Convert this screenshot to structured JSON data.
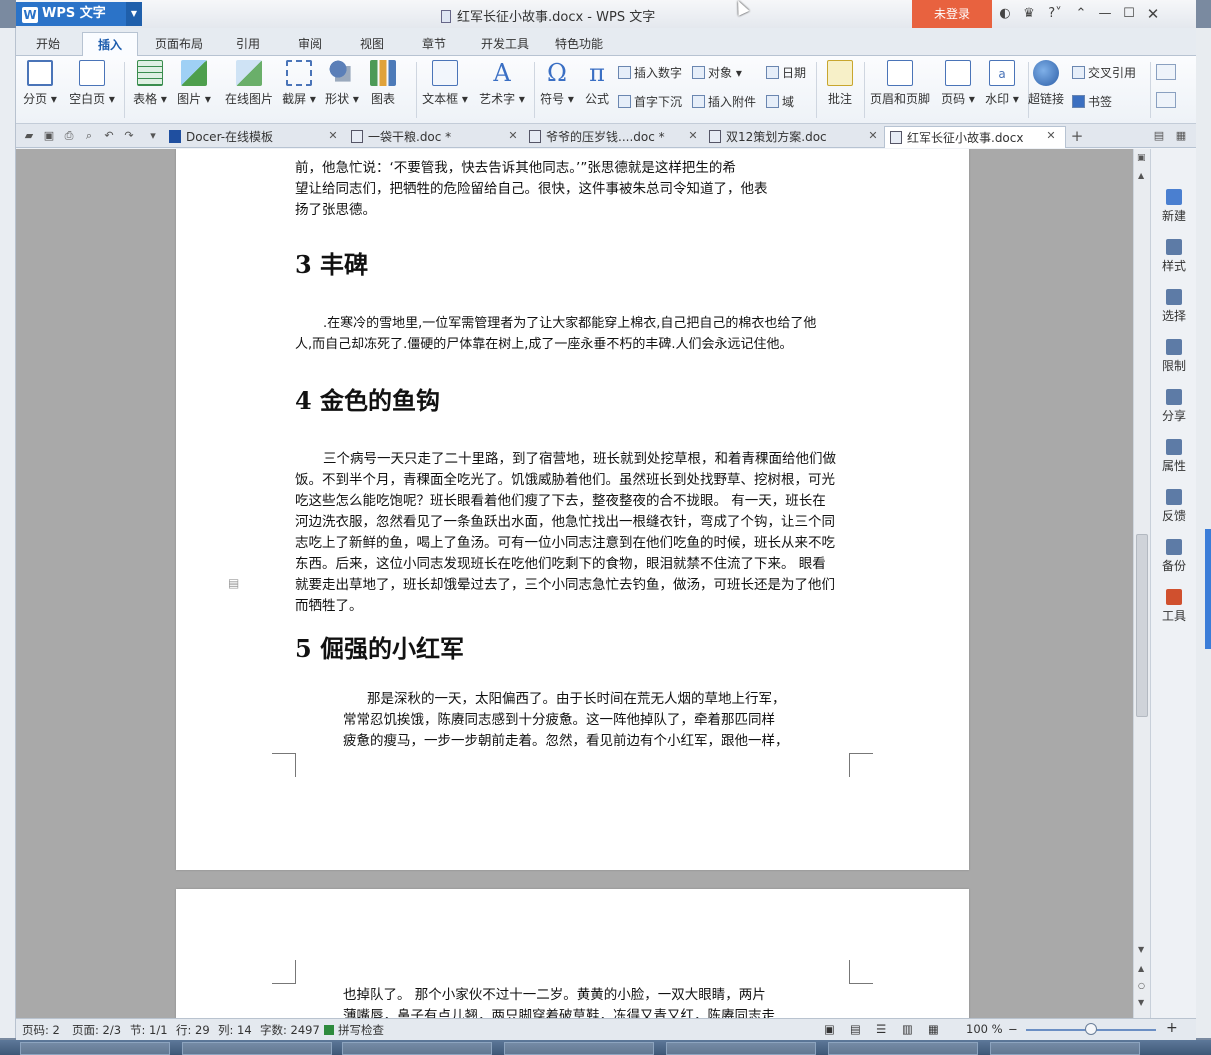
{
  "app": {
    "name": "WPS 文字",
    "window_title": "红军长征小故事.docx - WPS 文字",
    "login_label": "未登录"
  },
  "menu_tabs": [
    "开始",
    "插入",
    "页面布局",
    "引用",
    "审阅",
    "视图",
    "章节",
    "开发工具",
    "特色功能"
  ],
  "active_menu_tab": "插入",
  "ribbon": {
    "page_break": "分页",
    "blank_page": "空白页",
    "table": "表格",
    "picture": "图片",
    "online_picture": "在线图片",
    "screenshot": "截屏",
    "shape": "形状",
    "chart": "图表",
    "textbox": "文本框",
    "wordart": "艺术字",
    "symbol": "符号",
    "formula": "公式",
    "insert_number": "插入数字",
    "object": "对象",
    "date": "日期",
    "dropcap": "首字下沉",
    "attachment": "插入附件",
    "field": "域",
    "comment": "批注",
    "header_footer": "页眉和页脚",
    "page_number": "页码",
    "watermark": "水印",
    "hyperlink": "超链接",
    "cross_ref": "交叉引用",
    "bookmark": "书签"
  },
  "doc_tabs": [
    {
      "label": "Docer-在线模板"
    },
    {
      "label": "一袋干粮.doc *"
    },
    {
      "label": "爷爷的压岁钱....doc *"
    },
    {
      "label": "双12策划方案.doc"
    },
    {
      "label": "红军长征小故事.docx"
    }
  ],
  "document": {
    "top_text_lines": [
      "前，他急忙说：‘不要管我，快去告诉其他同志。’”张思德就是这样把生的希",
      "望让给同志们，把牺牲的危险留给自己。很快，这件事被朱总司令知道了，他表",
      "扬了张思德。"
    ],
    "sections": [
      {
        "heading": "3 丰碑",
        "lines": [
          ".在寒冷的雪地里,一位军需管理者为了让大家都能穿上棉衣,自己把自己的棉衣也给了他",
          "人,而自己却冻死了.僵硬的尸体靠在树上,成了一座永垂不朽的丰碑.人们会永远记住他。"
        ]
      },
      {
        "heading": "4 金色的鱼钩",
        "lines": [
          "三个病号一天只走了二十里路，到了宿营地，班长就到处挖草根，和着青稞面给他们做",
          "饭。不到半个月，青稞面全吃光了。饥饿威胁着他们。虽然班长到处找野草、挖树根，可光",
          "吃这些怎么能吃饱呢？班长眼看着他们瘦了下去，整夜整夜的合不拢眼。 有一天，班长在",
          "河边洗衣服，忽然看见了一条鱼跃出水面，他急忙找出一根缝衣针，弯成了个钩，让三个同",
          "志吃上了新鲜的鱼，喝上了鱼汤。可有一位小同志注意到在他们吃鱼的时候，班长从来不吃",
          "东西。后来，这位小同志发现班长在吃他们吃剩下的食物，眼泪就禁不住流了下来。 眼看",
          "就要走出草地了，班长却饿晕过去了，三个小同志急忙去钓鱼，做汤，可班长还是为了他们",
          "而牺牲了。"
        ]
      },
      {
        "heading": "5 倔强的小红军",
        "lines": [
          "那是深秋的一天，太阳偏西了。由于长时间在荒无人烟的草地上行军，",
          "常常忍饥挨饿，陈赓同志感到十分疲惫。这一阵他掉队了，牵着那匹同样",
          "疲惫的瘦马，一步一步朝前走着。忽然，看见前边有个小红军，跟他一样，"
        ]
      }
    ],
    "page2_lines": [
      "也掉队了。 那个小家伙不过十一二岁。黄黄的小脸，一双大眼睛，两片",
      "薄嘴唇，鼻子有点儿翘，两只脚穿着破草鞋，冻得又青又红，陈赓同志走"
    ]
  },
  "side_panel": [
    "新建",
    "样式",
    "选择",
    "限制",
    "分享",
    "属性",
    "反馈",
    "备份",
    "工具"
  ],
  "status": {
    "page_code": "页码: 2",
    "page": "页面: 2/3",
    "section": "节: 1/1",
    "row": "行: 29",
    "col": "列: 14",
    "word_count": "字数: 2497",
    "spellcheck": "拼写检查",
    "zoom": "100 %",
    "zoom_fraction": 0.5
  },
  "colors": {
    "accent": "#2b73c8",
    "login": "#e8623f"
  }
}
